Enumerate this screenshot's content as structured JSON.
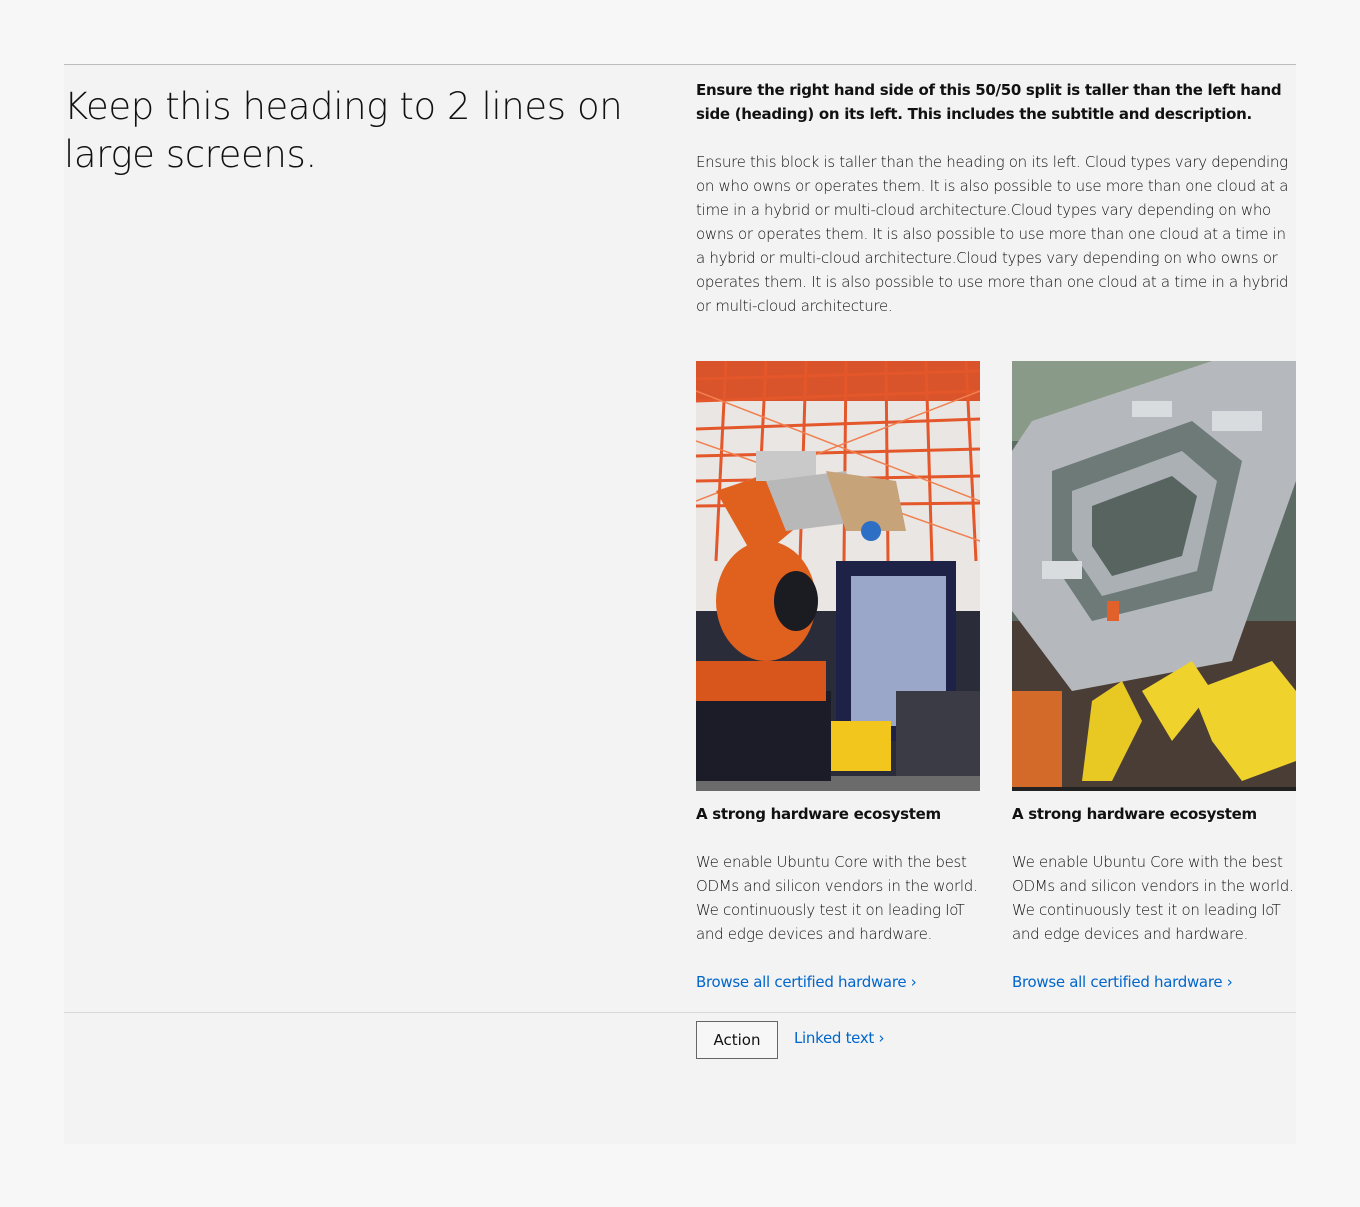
{
  "heading": "Keep this heading to 2 lines on large screens.",
  "subtitle": "Ensure the right hand side of this 50/50 split is taller than the left hand side (heading) on its left. This includes the subtitle and description.",
  "description": "Ensure this block is taller than the heading on its left. Cloud types vary depending on who owns or operates them. It is also possible to use more than one cloud at a time in a hybrid or multi-cloud architecture.Cloud types vary depending on who owns or operates them. It is also possible to use more than one cloud at a time in a hybrid or multi-cloud architecture.Cloud types vary depending on who owns or operates them. It is also possible to use more than one cloud at a time in a hybrid or multi-cloud architecture.",
  "cards": [
    {
      "title": "A strong hardware ecosystem",
      "text": "We enable Ubuntu Core with the best ODMs and silicon vendors in the world. We continuously test it on leading IoT and edge devices and hardware.",
      "link": "Browse all certified hardware ›"
    },
    {
      "title": "A strong hardware ecosystem",
      "text": "We enable Ubuntu Core with the best ODMs and silicon vendors in the world. We continuously test it on leading IoT and edge devices and hardware.",
      "link": "Browse all certified hardware ›"
    }
  ],
  "footer": {
    "action_label": "Action",
    "linked_text": "Linked text ›"
  },
  "colors": {
    "link": "#0066cc",
    "background": "#f3f3f3",
    "robot_orange": "#e0601e",
    "robot_yellow": "#f0d22c"
  }
}
